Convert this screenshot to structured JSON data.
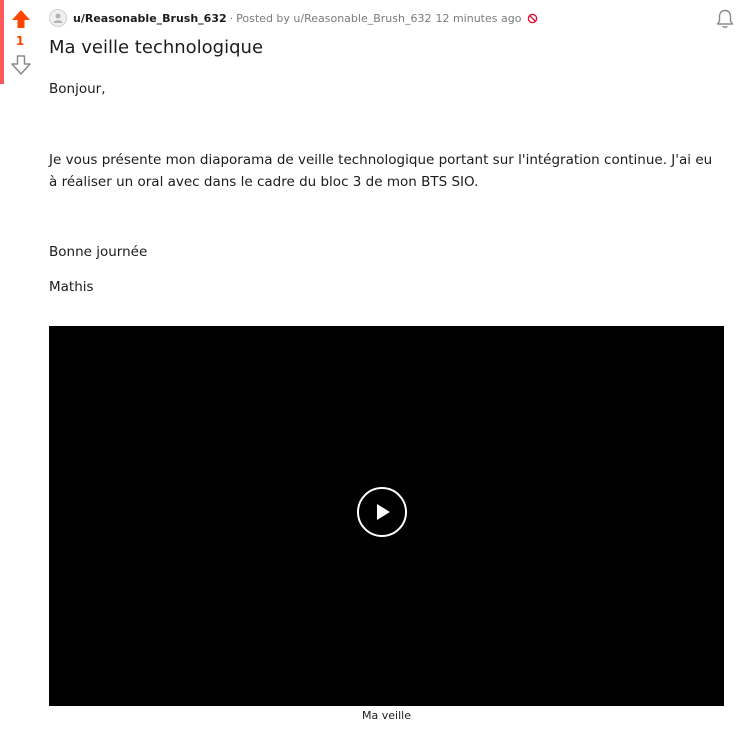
{
  "vote": {
    "count": "1",
    "upvote_color": "#ff4500",
    "accent_color": "#ff585b"
  },
  "meta": {
    "username": "u/Reasonable_Brush_632",
    "separator": "·",
    "posted_by": "Posted by u/Reasonable_Brush_632",
    "time": "12 minutes ago"
  },
  "post": {
    "title": "Ma veille technologique",
    "paragraphs": [
      "Bonjour,",
      "Je vous présente mon diaporama de veille technologique portant sur l'intégration continue. J'ai eu à réaliser un oral avec dans le cadre du bloc 3 de mon BTS SIO.",
      "Bonne journée",
      "Mathis"
    ]
  },
  "video": {
    "caption": "Ma veille"
  },
  "icons": {
    "upvote": "arrow-up-icon",
    "downvote": "arrow-down-icon",
    "avatar": "user-avatar-icon",
    "ban": "ban-icon",
    "notifications": "bell-icon",
    "play": "play-icon"
  }
}
